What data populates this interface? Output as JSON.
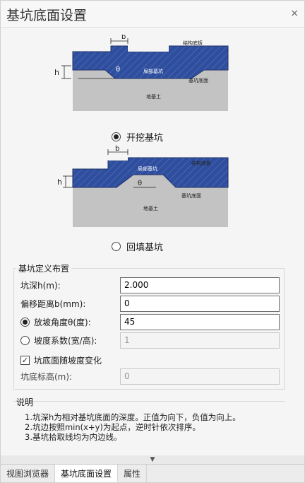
{
  "window": {
    "title": "基坑底面设置",
    "close_glyph": "×"
  },
  "diagram1": {
    "label_b": "b",
    "label_h": "h",
    "label_theta": "θ",
    "label_structure": "结构底板",
    "label_local": "局部基坑",
    "label_pit_bottom": "基坑底面",
    "label_ground": "地基土"
  },
  "diagram2": {
    "label_b": "b",
    "label_h": "h",
    "label_theta": "θ",
    "label_structure": "结构底板",
    "label_local": "局部基坑",
    "label_pit_bottom": "基坑底面",
    "label_ground": "地基土"
  },
  "options": {
    "excavate_label": "开挖基坑",
    "excavate_selected": true,
    "backfill_label": "回填基坑",
    "backfill_selected": false
  },
  "definition": {
    "group_title": "基坑定义布置",
    "depth_label": "坑深h(m):",
    "depth_value": "2.000",
    "offset_label": "偏移距离b(mm):",
    "offset_value": "0",
    "slope_angle_label": "放坡角度θ(度):",
    "slope_angle_value": "45",
    "slope_angle_selected": true,
    "slope_coef_label": "坡度系数(宽/高):",
    "slope_coef_value": "1",
    "slope_coef_selected": false,
    "follow_slope_label": "坑底面随坡度变化",
    "follow_slope_checked": true,
    "check_glyph": "✓",
    "bottom_elev_label": "坑底标高(m):",
    "bottom_elev_value": "0"
  },
  "notes": {
    "title": "说明",
    "line1": "1.坑深h为相对基坑底面的深度。正值为向下，负值为向上。",
    "line2": "2.坑边按照min(x+y)为起点，逆时针依次排序。",
    "line3": "3.基坑拾取线均为内边线。"
  },
  "scroll_glyph": "▼",
  "tabs": [
    "视图浏览器",
    "基坑底面设置",
    "属性"
  ],
  "colors": {
    "slab_blue": "#2f4f9e",
    "ground_gray": "#c3c3c3",
    "accent": "#333333"
  }
}
